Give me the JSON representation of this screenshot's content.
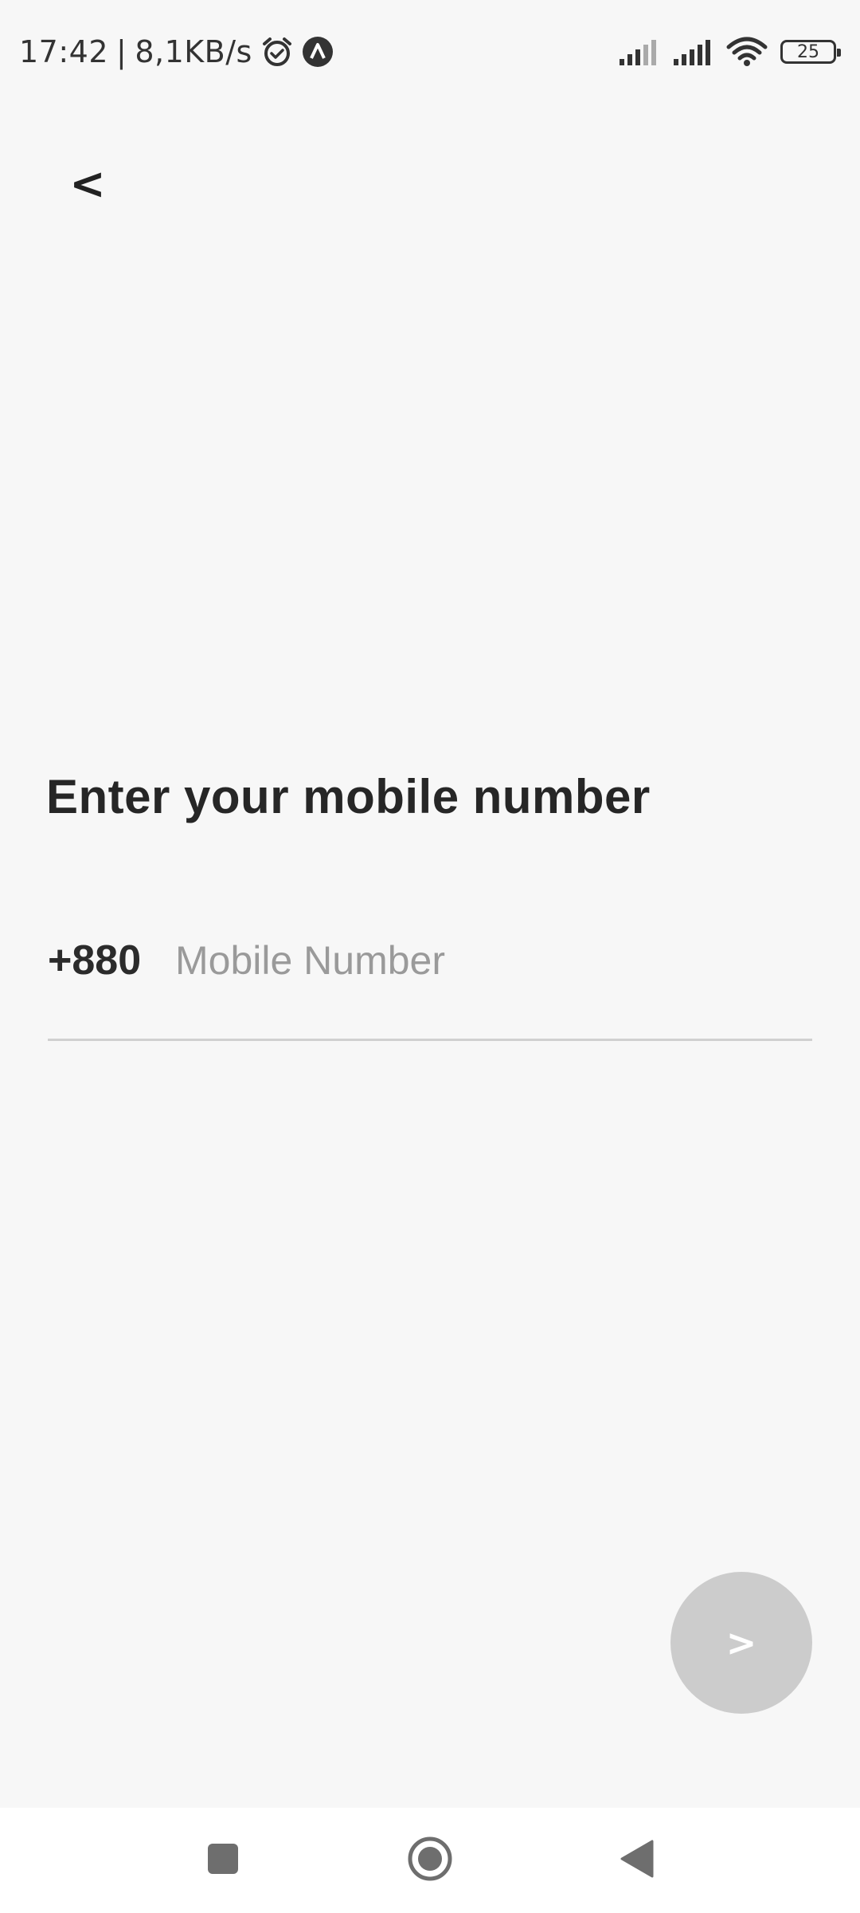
{
  "status_bar": {
    "time": "17:42",
    "separator": "|",
    "net_speed": "8,1KB/s",
    "icons": [
      "alarm-icon",
      "app-notification-icon",
      "signal-sim1-icon",
      "signal-sim2-icon",
      "wifi-icon",
      "battery-icon"
    ],
    "battery_level": "25"
  },
  "header": {
    "back_label": "<"
  },
  "main": {
    "title": "Enter your mobile number",
    "country_code": "+880",
    "mobile_input": {
      "value": "",
      "placeholder": "Mobile Number"
    },
    "next_label": ">"
  },
  "nav_bar": {
    "buttons": [
      "recents-icon",
      "home-icon",
      "back-icon"
    ]
  },
  "colors": {
    "background": "#f7f7f7",
    "next_button": "#cccccc",
    "underline": "#d0d0d0",
    "placeholder": "#9a9a9a"
  }
}
